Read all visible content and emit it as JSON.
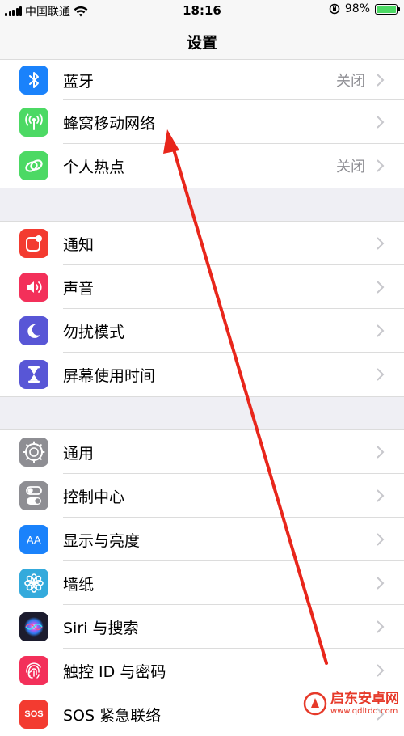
{
  "status_bar": {
    "carrier": "中国联通",
    "time": "18:16",
    "battery_percent": "98%",
    "battery_level": 0.98
  },
  "nav": {
    "title": "设置"
  },
  "groups": [
    {
      "rows": [
        {
          "label": "蓝牙",
          "value": "关闭",
          "icon": "bluetooth-icon",
          "color": "#1a82fb"
        },
        {
          "label": "蜂窝移动网络",
          "value": "",
          "icon": "cellular-icon",
          "color": "#4cd964"
        },
        {
          "label": "个人热点",
          "value": "关闭",
          "icon": "hotspot-icon",
          "color": "#4cd964"
        }
      ]
    },
    {
      "rows": [
        {
          "label": "通知",
          "value": "",
          "icon": "notifications-icon",
          "color": "#f33b30"
        },
        {
          "label": "声音",
          "value": "",
          "icon": "sound-icon",
          "color": "#f3305a"
        },
        {
          "label": "勿扰模式",
          "value": "",
          "icon": "moon-icon",
          "color": "#5856d6"
        },
        {
          "label": "屏幕使用时间",
          "value": "",
          "icon": "hourglass-icon",
          "color": "#5856d6"
        }
      ]
    },
    {
      "rows": [
        {
          "label": "通用",
          "value": "",
          "icon": "gear-icon",
          "color": "#8e8e93"
        },
        {
          "label": "控制中心",
          "value": "",
          "icon": "toggles-icon",
          "color": "#8e8e93"
        },
        {
          "label": "显示与亮度",
          "value": "",
          "icon": "display-icon",
          "color": "#1a82fb"
        },
        {
          "label": "墙纸",
          "value": "",
          "icon": "wallpaper-icon",
          "color": "#34aadc"
        },
        {
          "label": "Siri 与搜索",
          "value": "",
          "icon": "siri-icon",
          "color": "#1c1c2e"
        },
        {
          "label": "触控 ID 与密码",
          "value": "",
          "icon": "fingerprint-icon",
          "color": "#f3305a"
        },
        {
          "label": "SOS 紧急联络",
          "value": "",
          "icon": "sos-icon",
          "color": "#f33b30"
        }
      ]
    }
  ],
  "icon_labels": {
    "display": "AA",
    "sos": "SOS"
  },
  "watermark": {
    "name": "启东安卓网",
    "url": "www.qdltdq.com"
  }
}
